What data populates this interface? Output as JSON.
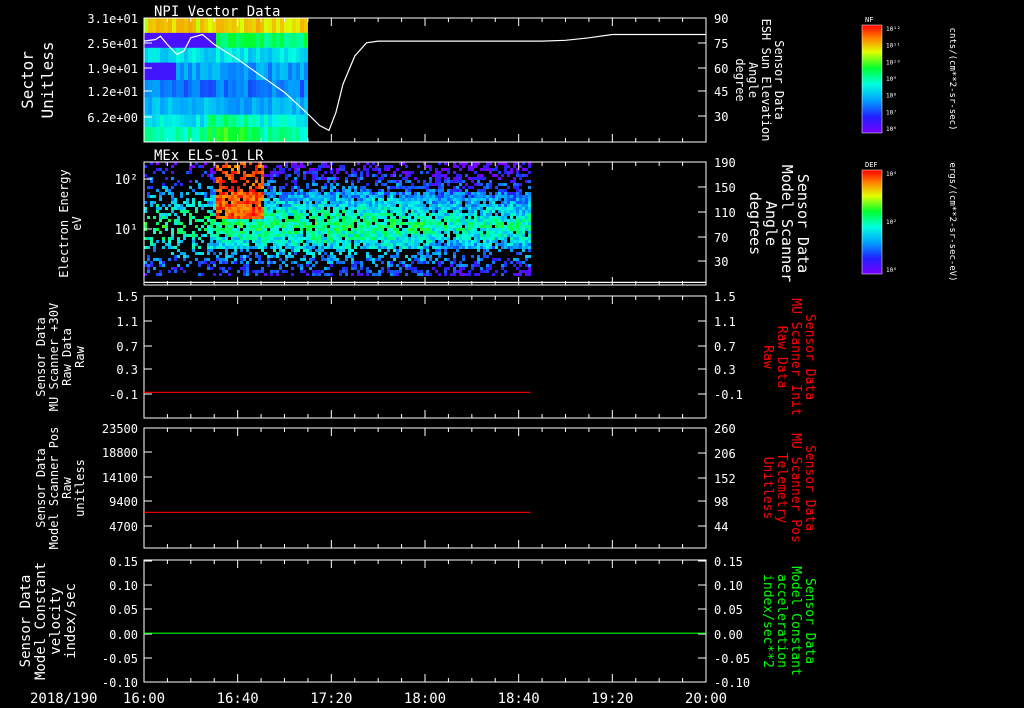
{
  "chart_data": {
    "type": "line",
    "date_label": "2018/190",
    "x_ticks": [
      "16:00",
      "16:40",
      "17:20",
      "18:00",
      "18:40",
      "19:20",
      "20:00"
    ],
    "x_range": [
      "16:00",
      "20:00"
    ],
    "panels": [
      {
        "title": "NPI Vector Data",
        "type": "spectrogram",
        "left_label": [
          "Sector",
          "Unitless"
        ],
        "left_ticks": [
          "3.1e+01",
          "2.5e+01",
          "1.9e+01",
          "1.2e+01",
          "6.2e+00"
        ],
        "right_label": [
          "Sensor Data",
          "ESH Sun Elevation",
          "Angle",
          "degree"
        ],
        "right_ticks": [
          "90",
          "75",
          "60",
          "45",
          "30"
        ],
        "right_range": [
          15,
          90
        ],
        "data_end": "17:10",
        "line_color": "#ffffff",
        "line": {
          "x": [
            "16:00",
            "16:05",
            "16:07",
            "16:10",
            "16:14",
            "16:17",
            "16:20",
            "16:25",
            "16:30",
            "16:40",
            "16:50",
            "17:00",
            "17:10",
            "17:15",
            "17:19",
            "17:22",
            "17:25",
            "17:30",
            "17:35",
            "17:40",
            "17:50",
            "18:00",
            "18:30",
            "18:50",
            "19:00",
            "19:10",
            "19:20",
            "19:30",
            "20:00"
          ],
          "y": [
            76,
            77,
            79,
            74,
            68,
            70,
            78,
            80,
            74,
            65,
            55,
            45,
            32,
            25,
            22,
            33,
            50,
            67,
            75,
            76,
            76,
            76,
            76,
            76,
            76.5,
            78,
            80,
            80,
            80
          ]
        }
      },
      {
        "title": "MEx ELS-01 LR",
        "type": "spectrogram",
        "left_label": [
          "Electron Energy",
          "eV"
        ],
        "left_ticks": [
          "10²",
          "10¹"
        ],
        "right_label": [
          "Sensor Data",
          "Model Scanner",
          "Angle",
          "degrees"
        ],
        "right_ticks": [
          "190",
          "150",
          "110",
          "70",
          "30"
        ],
        "right_range": [
          0,
          190
        ],
        "data_end": "18:45",
        "line_color": "#ffffff",
        "line": {
          "x": [
            "16:00",
            "20:00"
          ],
          "y": [
            4,
            4
          ]
        }
      },
      {
        "type": "line",
        "left_label": [
          "Sensor Data",
          "MU Scanner +30V",
          "Raw Data",
          "Raw"
        ],
        "left_ticks": [
          "1.5",
          "1.1",
          "0.7",
          "0.3",
          "-0.1"
        ],
        "right_label": [
          "Sensor Data",
          "MU Scanner Init",
          "Raw Data",
          "Raw"
        ],
        "right_ticks": [
          "1.5",
          "1.1",
          "0.7",
          "0.3",
          "-0.1"
        ],
        "range": [
          -0.4,
          1.5
        ],
        "right_color": "#ff0000",
        "line_color": "#ff0000",
        "line": {
          "x": [
            "16:00",
            "18:45"
          ],
          "y": [
            0.0,
            0.0
          ]
        }
      },
      {
        "type": "line",
        "left_label": [
          "Sensor Data",
          "Model Scanner Pos",
          "Raw",
          "unitless"
        ],
        "left_ticks": [
          "23500",
          "18800",
          "14100",
          "9400",
          "4700"
        ],
        "right_label": [
          "Sensor Data",
          "MU Scanner Pos",
          "Telemetry",
          "Unitless"
        ],
        "right_ticks": [
          "260",
          "206",
          "152",
          "98",
          "44"
        ],
        "range": [
          0,
          23500
        ],
        "right_color": "#ff0000",
        "line_color": "#ff0000",
        "line": {
          "x": [
            "16:00",
            "18:45"
          ],
          "y": [
            7000,
            7000
          ]
        }
      },
      {
        "type": "line",
        "left_label": [
          "Sensor Data",
          "Model Constant",
          "velocity",
          "index/sec"
        ],
        "left_ticks": [
          "0.15",
          "0.10",
          "0.05",
          "0.00",
          "-0.05",
          "-0.10"
        ],
        "right_label": [
          "Sensor Data",
          "Model Constant",
          "acceleration",
          "index/sec**2"
        ],
        "right_ticks": [
          "0.15",
          "0.10",
          "0.05",
          "0.00",
          "-0.05",
          "-0.10"
        ],
        "range": [
          -0.1,
          0.15
        ],
        "right_color": "#00ff00",
        "line_color": "#00ff00",
        "line": {
          "x": [
            "16:00",
            "20:00"
          ],
          "y": [
            0.0,
            0.0
          ]
        }
      }
    ],
    "colorbars": [
      {
        "label": "NF",
        "unit": "cnts/(cm**2-sr-sec)",
        "ticks": [
          "10¹²",
          "10¹¹",
          "10¹⁰",
          "10⁹",
          "10⁸",
          "10⁷",
          "10⁶"
        ]
      },
      {
        "label": "DEF",
        "unit": "ergs/(cm**2-sr-sec-eV)",
        "ticks": [
          "10⁴",
          "10²",
          "10⁰"
        ]
      }
    ]
  }
}
